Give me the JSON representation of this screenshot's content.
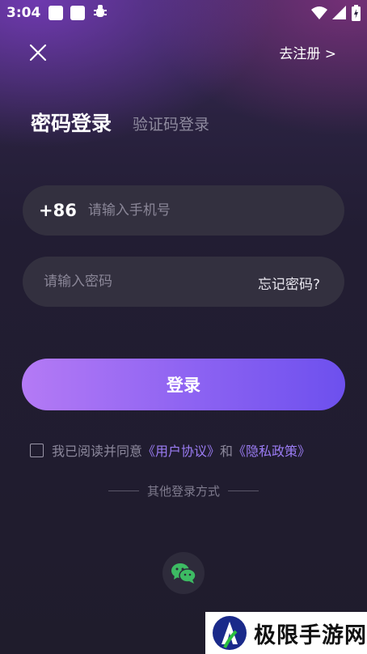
{
  "status_bar": {
    "time": "3:04",
    "icons": [
      "app-notification-icon",
      "app-notification-icon",
      "bug-icon",
      "wifi-icon",
      "signal-icon",
      "battery-charging-icon"
    ]
  },
  "header": {
    "close_icon": "close-icon",
    "register_label": "去注册 >"
  },
  "tabs": {
    "password_login": "密码登录",
    "code_login": "验证码登录"
  },
  "phone_field": {
    "country_code": "+86",
    "placeholder": "请输入手机号",
    "value": ""
  },
  "password_field": {
    "placeholder": "请输入密码",
    "value": "",
    "forgot_label": "忘记密码?"
  },
  "login_button_label": "登录",
  "agreement": {
    "checked": false,
    "prefix": "我已阅读并同意",
    "user_agreement": "《用户协议》",
    "and": "和",
    "privacy_policy": "《隐私政策》"
  },
  "other_login": {
    "label": "其他登录方式",
    "wechat_icon": "wechat-icon"
  },
  "watermark": {
    "text": "极限手游网"
  },
  "colors": {
    "background": "#1e1c2b",
    "field": "#33303f",
    "accent_start": "#b47af5",
    "accent_end": "#6d50ee",
    "link": "#9b7cf4",
    "wechat": "#3dbb63"
  }
}
